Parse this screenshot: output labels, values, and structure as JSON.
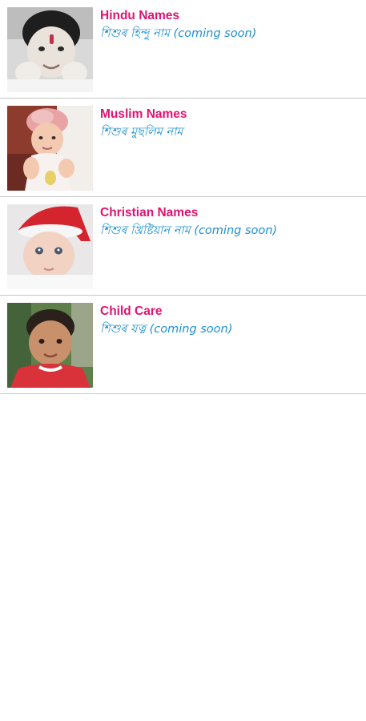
{
  "colors": {
    "title": "#e0136f",
    "subtitle": "#1a8fd4",
    "divider": "#c7c7c7",
    "background": "#ffffff"
  },
  "items": [
    {
      "title": "Hindu Names",
      "subtitle": "শিশুৰ হিন্দু নাম (coming soon)",
      "image": "baby-photo-hindu"
    },
    {
      "title": "Muslim Names",
      "subtitle": "শিশুৰ মুছলিম নাম",
      "image": "baby-photo-muslim"
    },
    {
      "title": "Christian Names",
      "subtitle": "শিশুৰ খ্রিষ্টিয়ান নাম (coming soon)",
      "image": "baby-photo-christian"
    },
    {
      "title": "Child Care",
      "subtitle": "শিশুৰ যত্ন (coming soon)",
      "image": "child-photo-care"
    }
  ]
}
